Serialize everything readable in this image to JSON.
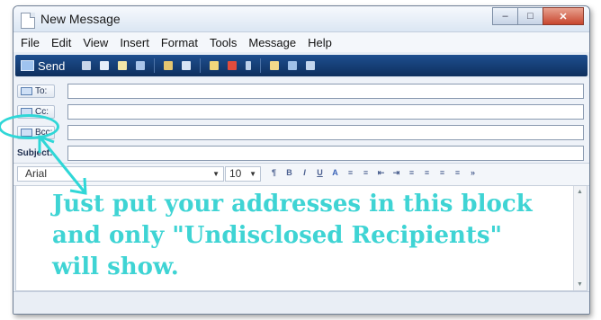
{
  "window": {
    "title": "New Message",
    "controls": [
      "minimize",
      "maximize",
      "close"
    ]
  },
  "menu": [
    "File",
    "Edit",
    "View",
    "Insert",
    "Format",
    "Tools",
    "Message",
    "Help"
  ],
  "toolbar": {
    "send_label": "Send"
  },
  "fields": {
    "to_label": "To:",
    "to_value": "",
    "cc_label": "Cc:",
    "cc_value": "",
    "bcc_label": "Bcc:",
    "bcc_value": "",
    "subject_label": "Subject:",
    "subject_value": ""
  },
  "format": {
    "font": "Arial",
    "size": "10"
  },
  "annotation": {
    "text": "Just put your addresses in this block\nand only \"Undisclosed Recipients\"\nwill show.",
    "color": "#3fd4d4"
  }
}
